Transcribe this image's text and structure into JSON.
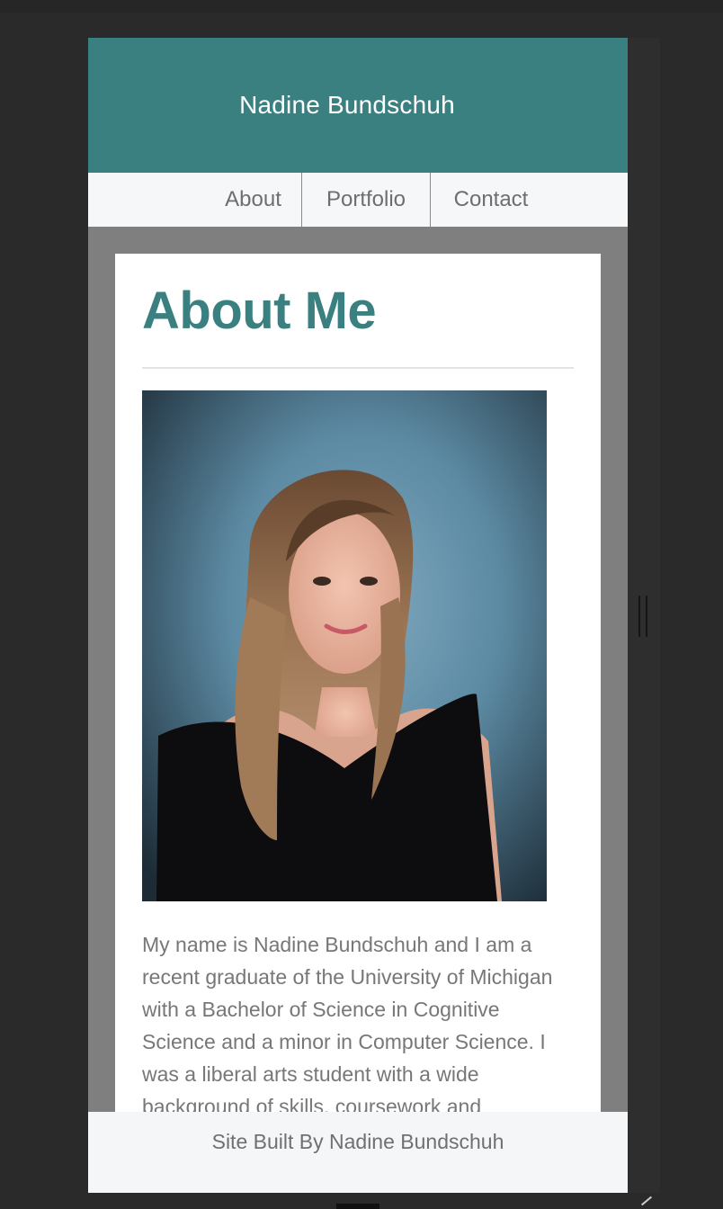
{
  "header": {
    "site_title": "Nadine Bundschuh"
  },
  "nav": {
    "items": [
      {
        "label": "About"
      },
      {
        "label": "Portfolio"
      },
      {
        "label": "Contact"
      }
    ]
  },
  "main": {
    "title": "About Me",
    "bio": "My name is Nadine Bundschuh and I am a recent graduate of the University of Michigan with a Bachelor of Science in Cognitive Science and a minor in Computer Science. I was a liberal arts student with a wide background of skills, coursework and"
  },
  "footer": {
    "text": "Site Built By Nadine Bundschuh"
  },
  "colors": {
    "brand_teal": "#3a8080",
    "nav_bg": "#f6f7f9",
    "page_bg": "#7f7f7f"
  }
}
